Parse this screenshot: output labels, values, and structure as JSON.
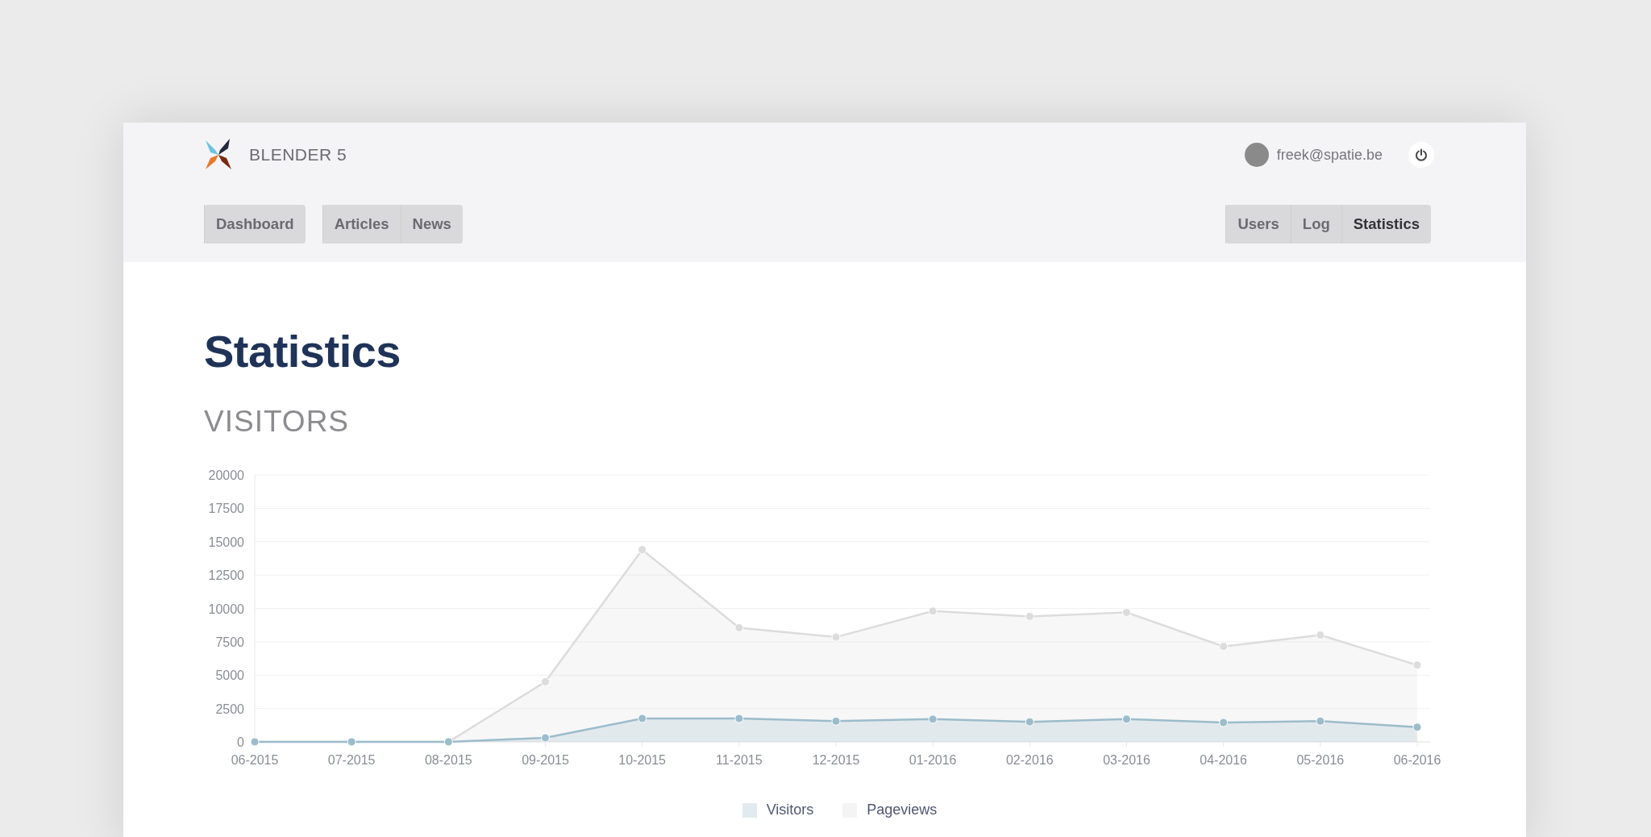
{
  "header": {
    "brand": "BLENDER 5",
    "user_email": "freek@spatie.be"
  },
  "nav_left": [
    {
      "items": [
        {
          "label": "Dashboard",
          "selected": false
        }
      ]
    },
    {
      "items": [
        {
          "label": "Articles",
          "selected": false
        },
        {
          "label": "News",
          "selected": false
        }
      ]
    }
  ],
  "nav_right": [
    {
      "items": [
        {
          "label": "Users",
          "selected": false
        },
        {
          "label": "Log",
          "selected": false
        },
        {
          "label": "Statistics",
          "selected": true
        }
      ]
    }
  ],
  "page": {
    "title": "Statistics",
    "section": "VISITORS"
  },
  "chart_data": {
    "type": "area",
    "categories": [
      "06-2015",
      "07-2015",
      "08-2015",
      "09-2015",
      "10-2015",
      "11-2015",
      "12-2015",
      "01-2016",
      "02-2016",
      "03-2016",
      "04-2016",
      "05-2016",
      "06-2016"
    ],
    "series": [
      {
        "name": "Visitors",
        "color": "#9bbccb",
        "values": [
          0,
          0,
          0,
          300,
          1750,
          1750,
          1550,
          1700,
          1500,
          1700,
          1450,
          1550,
          1100
        ]
      },
      {
        "name": "Pageviews",
        "color": "#dcdcdc",
        "values": [
          0,
          0,
          0,
          4500,
          14400,
          8550,
          7850,
          9800,
          9400,
          9700,
          7150,
          8000,
          5750
        ]
      }
    ],
    "grid": true,
    "ylim": [
      0,
      20000
    ],
    "yticks": [
      0,
      2500,
      5000,
      7500,
      10000,
      12500,
      15000,
      17500,
      20000
    ]
  }
}
